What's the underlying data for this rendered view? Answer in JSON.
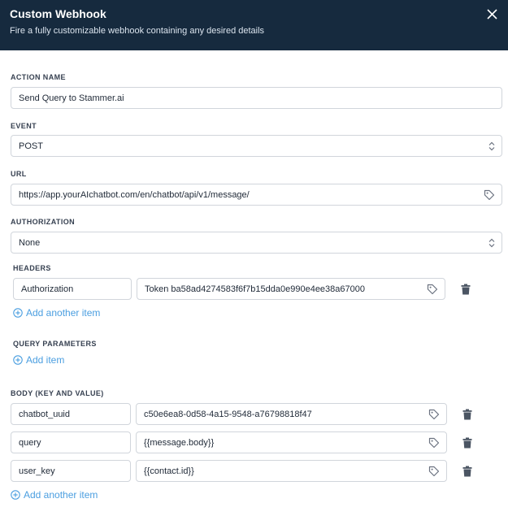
{
  "header": {
    "title": "Custom Webhook",
    "subtitle": "Fire a fully customizable webhook containing any desired details"
  },
  "action_name": {
    "label": "ACTION NAME",
    "value": "Send Query to Stammer.ai"
  },
  "event": {
    "label": "EVENT",
    "value": "POST"
  },
  "url": {
    "label": "URL",
    "value": "https://app.yourAIchatbot.com/en/chatbot/api/v1/message/"
  },
  "authorization": {
    "label": "AUTHORIZATION",
    "value": "None"
  },
  "headers": {
    "label": "HEADERS",
    "rows": [
      {
        "key": "Authorization",
        "value": "Token ba58ad4274583f6f7b15dda0e990e4ee38a67000"
      }
    ],
    "add_label": "Add another item"
  },
  "query_parameters": {
    "label": "QUERY PARAMETERS",
    "add_label": "Add item"
  },
  "body": {
    "label": "BODY (KEY AND VALUE)",
    "rows": [
      {
        "key": "chatbot_uuid",
        "value": "c50e6ea8-0d58-4a15-9548-a76798818f47"
      },
      {
        "key": "query",
        "value": "{{message.body}}"
      },
      {
        "key": "user_key",
        "value": "{{contact.id}}"
      }
    ],
    "add_label": "Add another item"
  },
  "colors": {
    "header_bg": "#162a3e",
    "link": "#4a9ee0",
    "border": "#d1d5db"
  }
}
